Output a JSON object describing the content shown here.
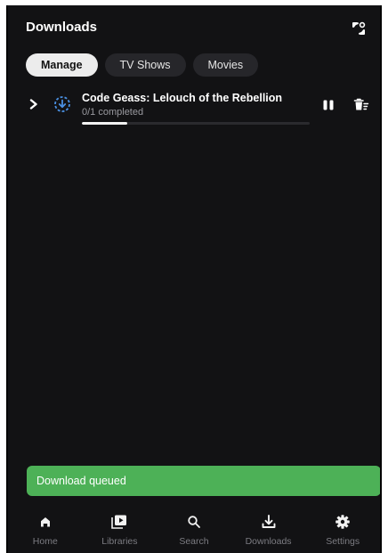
{
  "header": {
    "title": "Downloads",
    "sync_icon": "sync-icon"
  },
  "tabs": [
    {
      "label": "Manage",
      "active": true
    },
    {
      "label": "TV Shows",
      "active": false
    },
    {
      "label": "Movies",
      "active": false
    }
  ],
  "downloads": [
    {
      "title": "Code Geass: Lelouch of the Rebellion",
      "status": "0/1 completed",
      "progress": 0.2,
      "status_icon": "download-queued-icon",
      "status_color": "#4a90e2"
    }
  ],
  "snackbar": {
    "message": "Download queued",
    "color": "#4db157"
  },
  "nav": [
    {
      "label": "Home",
      "icon": "home-icon"
    },
    {
      "label": "Libraries",
      "icon": "libraries-icon"
    },
    {
      "label": "Search",
      "icon": "search-icon"
    },
    {
      "label": "Downloads",
      "icon": "downloads-icon"
    },
    {
      "label": "Settings",
      "icon": "settings-icon"
    }
  ],
  "colors": {
    "background": "#121214",
    "accent": "#4a90e2",
    "chip_active": "#ececec",
    "chip_inactive": "#26262a",
    "snackbar": "#4db157"
  }
}
